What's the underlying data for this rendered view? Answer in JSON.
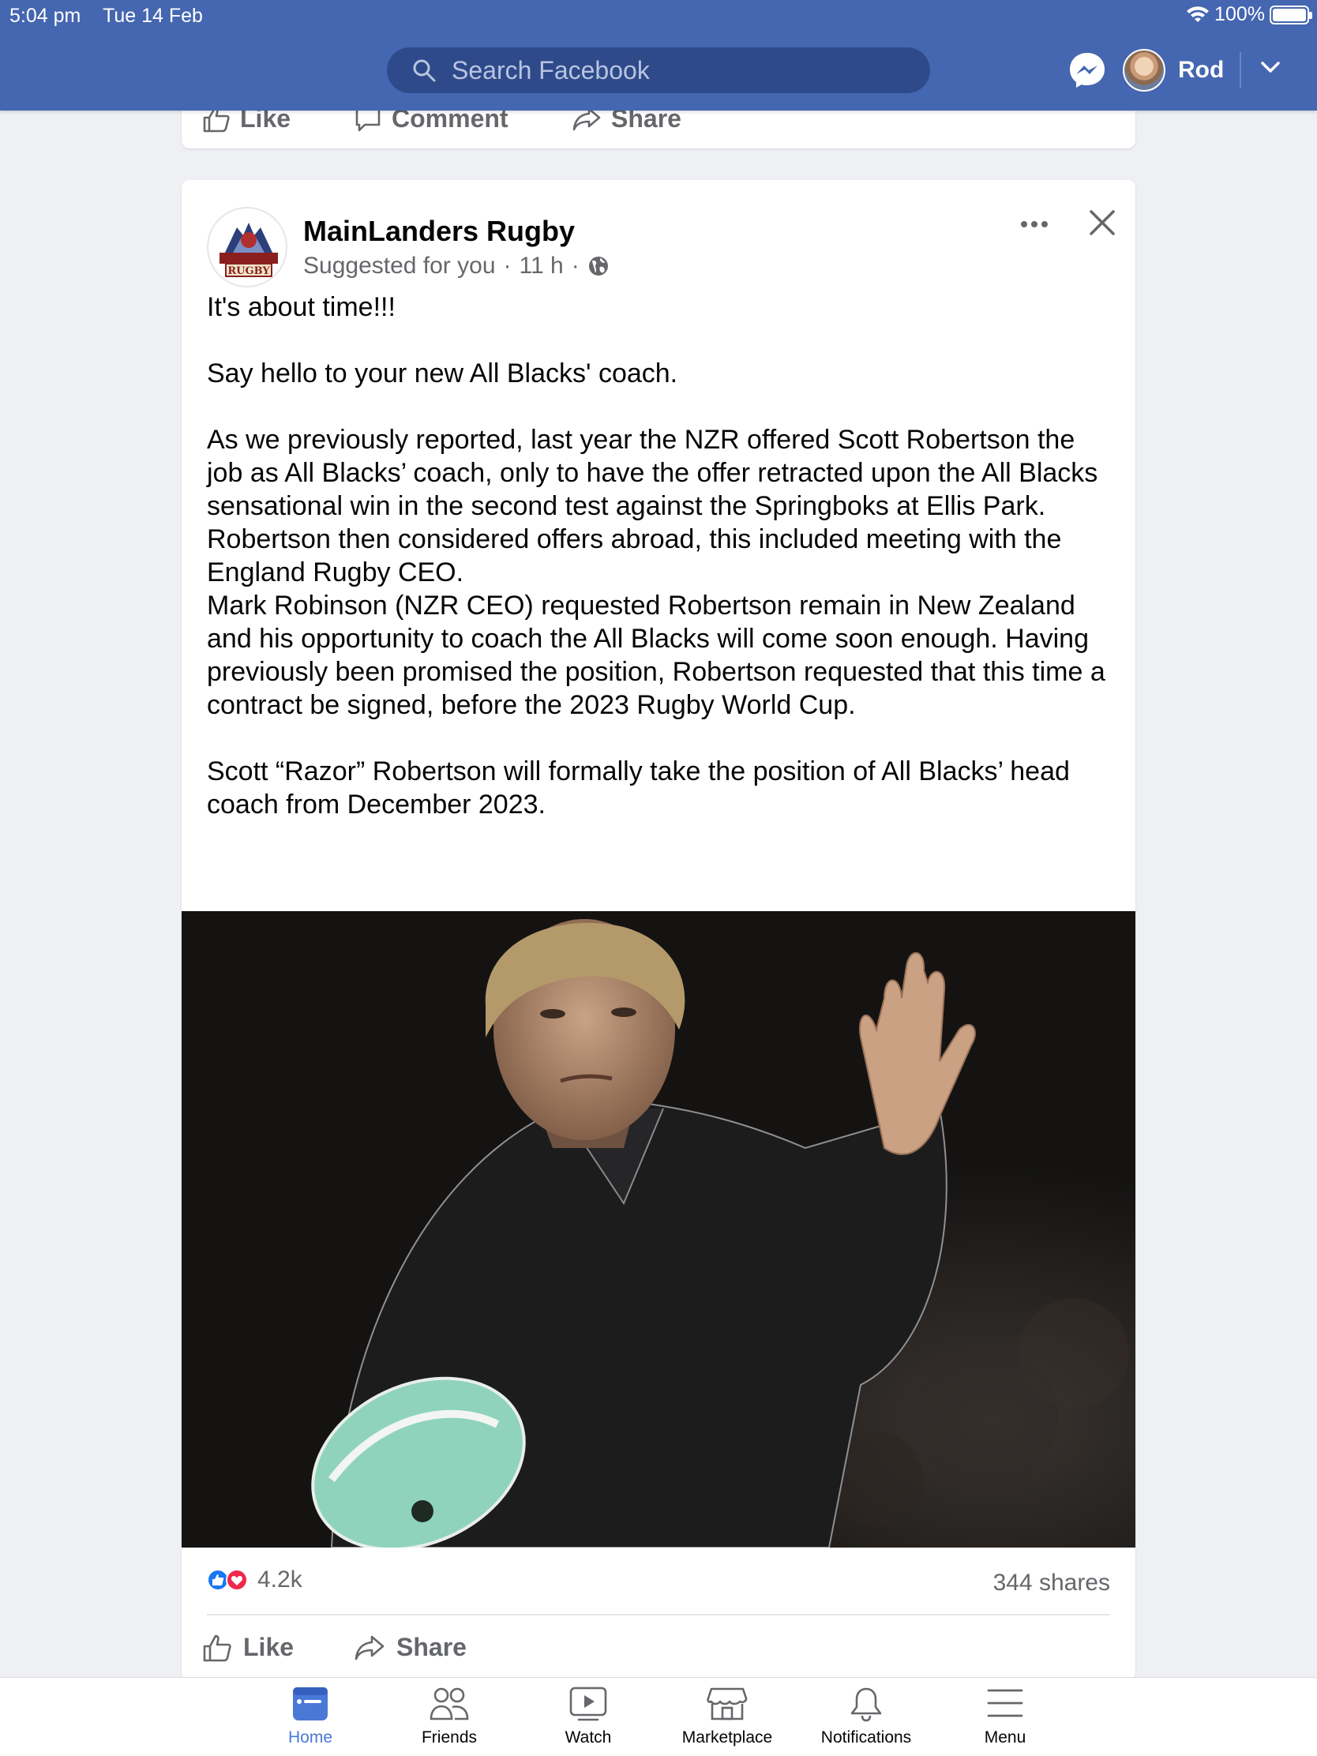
{
  "status_bar": {
    "time": "5:04 pm",
    "date": "Tue 14 Feb",
    "battery": "100%",
    "battery_level": 1.0
  },
  "header": {
    "search": {
      "placeholder": "Search Facebook"
    },
    "user_name": "Rod",
    "icons": [
      "search-icon",
      "messenger-icon",
      "avatar",
      "chevron-down-icon"
    ]
  },
  "previous_post": {
    "actions": [
      {
        "label": "Like",
        "icon": "like-icon"
      },
      {
        "label": "Comment",
        "icon": "comment-icon"
      },
      {
        "label": "Share",
        "icon": "share-icon"
      }
    ]
  },
  "post": {
    "page_name": "MainLanders Rugby",
    "suggested": "Suggested for you",
    "time": "11 h",
    "logo_text": "RUGBY",
    "text": "It's about time!!!\n\nSay hello to your new All Blacks' coach.\n\nAs we previously reported, last year the NZR offered Scott Robertson the job as All Blacks’ coach, only to have the offer retracted upon the All Blacks sensational win in the second test against the Springboks at Ellis Park.\nRobertson then considered offers abroad, this included meeting with the England Rugby CEO.\nMark Robinson (NZR CEO) requested Robertson remain in New Zealand and his opportunity to coach the All Blacks will come soon enough. Having previously been promised the position, Robertson requested that this time a contract be signed, before the 2023 Rugby World Cup.\n\nScott “Razor” Robertson will formally take the position of All Blacks’ head coach from December 2023.",
    "reaction_count": "4.2k",
    "shares": "344 shares",
    "actions": [
      {
        "label": "Like",
        "icon": "like-icon"
      },
      {
        "label": "Share",
        "icon": "share-icon"
      }
    ]
  },
  "bottom_nav": [
    {
      "label": "Home",
      "icon": "home-icon",
      "active": true
    },
    {
      "label": "Friends",
      "icon": "friends-icon",
      "active": false
    },
    {
      "label": "Watch",
      "icon": "watch-icon",
      "active": false
    },
    {
      "label": "Marketplace",
      "icon": "marketplace-icon",
      "active": false
    },
    {
      "label": "Notifications",
      "icon": "bell-icon",
      "active": false
    },
    {
      "label": "Menu",
      "icon": "menu-icon",
      "active": false
    }
  ],
  "colors": {
    "brand_bar": "#4566b0",
    "search_bg": "#2e4a8a",
    "active_tab": "#4a78d6",
    "muted_text": "#65676b"
  }
}
